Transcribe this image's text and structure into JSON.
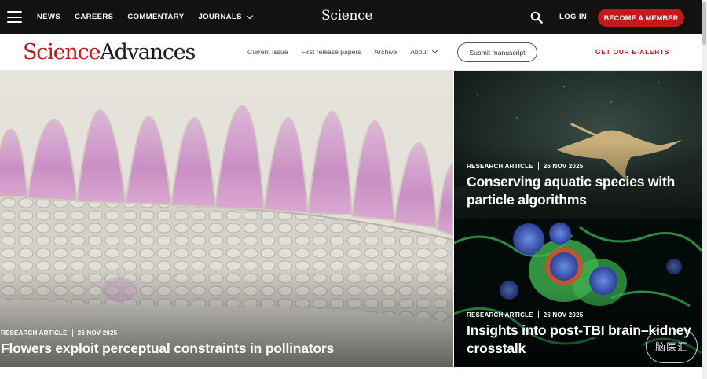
{
  "topbar": {
    "nav": [
      {
        "label": "NEWS"
      },
      {
        "label": "CAREERS"
      },
      {
        "label": "COMMENTARY"
      },
      {
        "label": "JOURNALS"
      }
    ],
    "science_logo": "Science",
    "login_label": "LOG IN",
    "member_button": "BECOME A MEMBER"
  },
  "journal": {
    "brand_part1": "Science",
    "brand_part2": "Advances",
    "nav": [
      {
        "label": "Current Issue"
      },
      {
        "label": "First release papers"
      },
      {
        "label": "Archive"
      },
      {
        "label": "About"
      }
    ],
    "submit_label": "Submit manuscript",
    "alerts_label": "GET OUR E-ALERTS"
  },
  "hero": {
    "main": {
      "type": "RESEARCH ARTICLE",
      "date": "26 NOV 2025",
      "title": "Flowers exploit perceptual constraints in pollinators"
    },
    "side1": {
      "type": "RESEARCH ARTICLE",
      "date": "26 NOV 2025",
      "title": "Conserving aquatic species with particle algorithms"
    },
    "side2": {
      "type": "RESEARCH ARTICLE",
      "date": "26 NOV 2025",
      "title": "Insights into post-TBI brain–kidney crosstalk"
    }
  },
  "watermark": "脑医汇",
  "colors": {
    "brand_red": "#c4181b",
    "topbar_bg": "#121212"
  },
  "icons": {
    "menu": "hamburger-icon",
    "search": "search-icon",
    "chevron": "chevron-down-icon"
  }
}
